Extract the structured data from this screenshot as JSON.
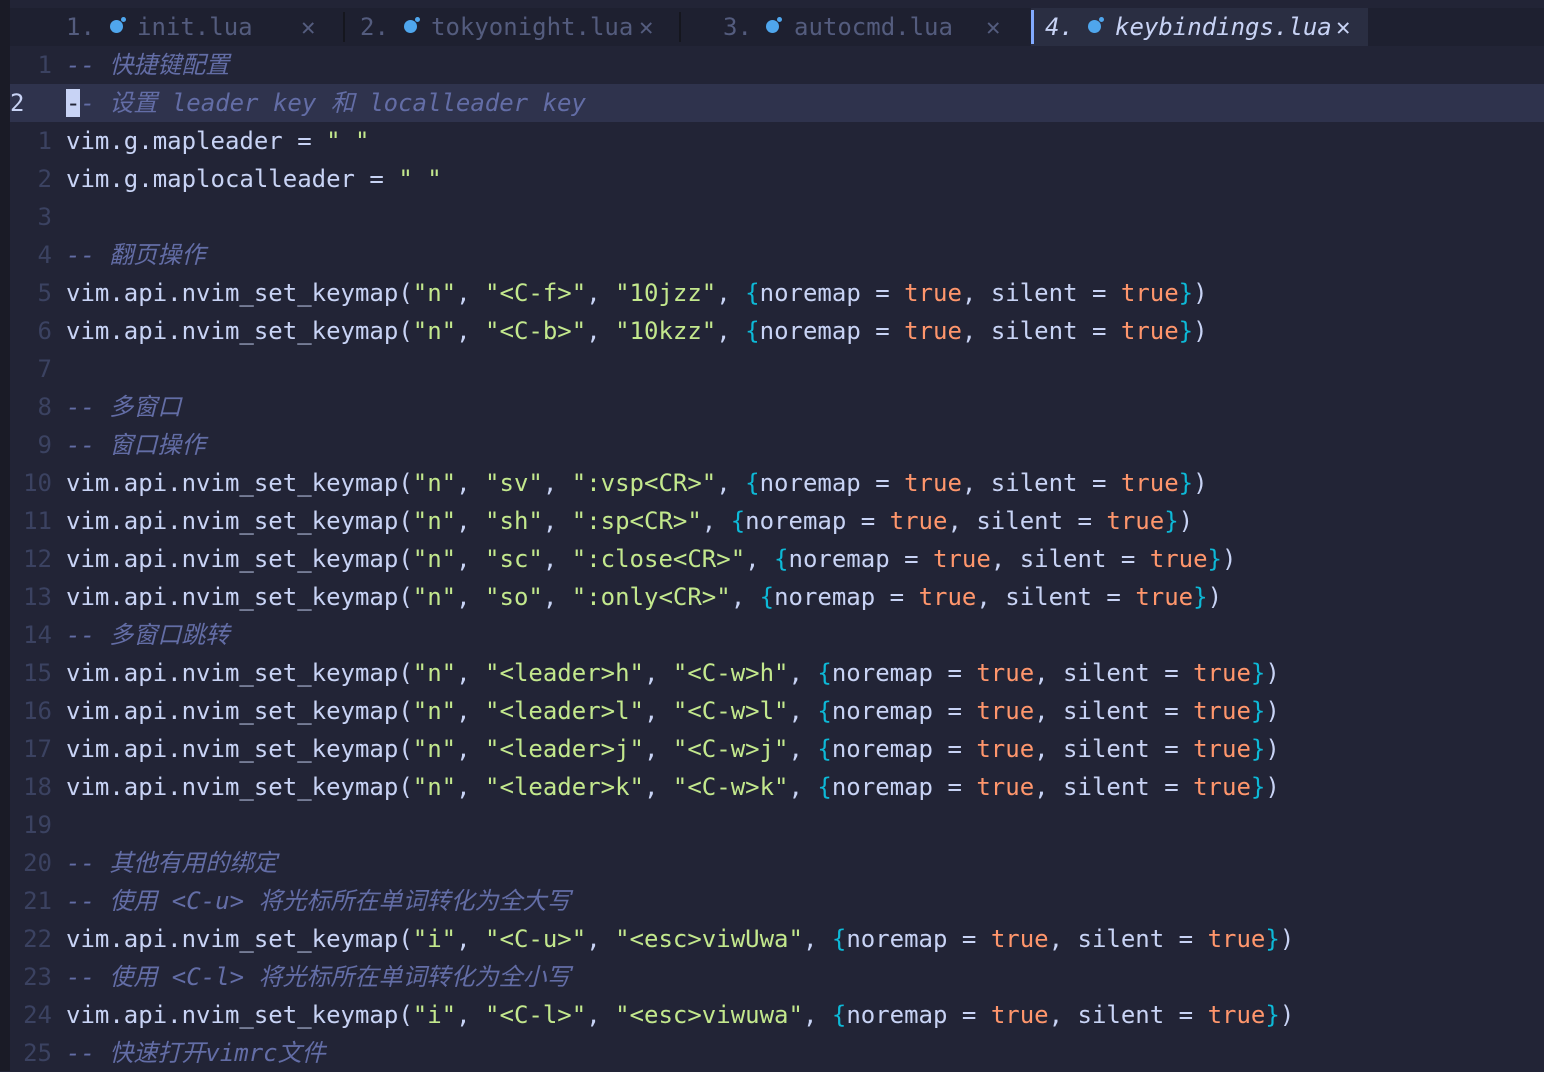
{
  "colors": {
    "background": "#222436",
    "tabbar_background": "#1e2030",
    "active_tab_background": "#2a2e42",
    "cursorline": "#2f334d",
    "foreground": "#c8d3f5",
    "comment": "#636da6",
    "string": "#c3e88d",
    "boolean": "#ff966c",
    "brace": "#0db9d7",
    "line_number": "#3b4261",
    "lua_icon": "#4fa6ed"
  },
  "tabs": [
    {
      "number": "1.",
      "name": "init.lua",
      "icon": "lua-icon",
      "close": "✕",
      "active": false
    },
    {
      "number": "2.",
      "name": "tokyonight.lua",
      "icon": "lua-icon",
      "close": "✕",
      "active": false
    },
    {
      "number": "3.",
      "name": "autocmd.lua",
      "icon": "lua-icon",
      "close": "✕",
      "active": false
    },
    {
      "number": "4.",
      "name": "keybindings.lua",
      "icon": "lua-icon",
      "close": "✕",
      "active": true
    }
  ],
  "editor": {
    "cursor_line": 2,
    "lines": [
      {
        "ln": "1",
        "cur": false,
        "tokens": [
          {
            "t": "-- 快捷键配置",
            "c": "cmt"
          }
        ]
      },
      {
        "ln": "2",
        "cur": true,
        "tokens": [
          {
            "t": "-",
            "c": "cursor"
          },
          {
            "t": "- 设置 leader key 和 localleader key",
            "c": "cmt"
          }
        ]
      },
      {
        "ln": "1",
        "cur": false,
        "tokens": [
          {
            "t": "vim.g.mapleader = ",
            "c": "punc"
          },
          {
            "t": "\" \"",
            "c": "str"
          }
        ]
      },
      {
        "ln": "2",
        "cur": false,
        "tokens": [
          {
            "t": "vim.g.maplocalleader = ",
            "c": "punc"
          },
          {
            "t": "\" \"",
            "c": "str"
          }
        ]
      },
      {
        "ln": "3",
        "cur": false,
        "tokens": []
      },
      {
        "ln": "4",
        "cur": false,
        "tokens": [
          {
            "t": "-- 翻页操作",
            "c": "cmt"
          }
        ]
      },
      {
        "ln": "5",
        "cur": false,
        "tokens": [
          {
            "t": "vim.api.nvim_set_keymap(",
            "c": "punc"
          },
          {
            "t": "\"n\"",
            "c": "str"
          },
          {
            "t": ", ",
            "c": "punc"
          },
          {
            "t": "\"<C-f>\"",
            "c": "str"
          },
          {
            "t": ", ",
            "c": "punc"
          },
          {
            "t": "\"10jzz\"",
            "c": "str"
          },
          {
            "t": ", ",
            "c": "punc"
          },
          {
            "t": "{",
            "c": "brace"
          },
          {
            "t": "noremap = ",
            "c": "punc"
          },
          {
            "t": "true",
            "c": "bool"
          },
          {
            "t": ", silent = ",
            "c": "punc"
          },
          {
            "t": "true",
            "c": "bool"
          },
          {
            "t": "}",
            "c": "brace"
          },
          {
            "t": ")",
            "c": "punc"
          }
        ]
      },
      {
        "ln": "6",
        "cur": false,
        "tokens": [
          {
            "t": "vim.api.nvim_set_keymap(",
            "c": "punc"
          },
          {
            "t": "\"n\"",
            "c": "str"
          },
          {
            "t": ", ",
            "c": "punc"
          },
          {
            "t": "\"<C-b>\"",
            "c": "str"
          },
          {
            "t": ", ",
            "c": "punc"
          },
          {
            "t": "\"10kzz\"",
            "c": "str"
          },
          {
            "t": ", ",
            "c": "punc"
          },
          {
            "t": "{",
            "c": "brace"
          },
          {
            "t": "noremap = ",
            "c": "punc"
          },
          {
            "t": "true",
            "c": "bool"
          },
          {
            "t": ", silent = ",
            "c": "punc"
          },
          {
            "t": "true",
            "c": "bool"
          },
          {
            "t": "}",
            "c": "brace"
          },
          {
            "t": ")",
            "c": "punc"
          }
        ]
      },
      {
        "ln": "7",
        "cur": false,
        "tokens": []
      },
      {
        "ln": "8",
        "cur": false,
        "tokens": [
          {
            "t": "-- 多窗口",
            "c": "cmt"
          }
        ]
      },
      {
        "ln": "9",
        "cur": false,
        "tokens": [
          {
            "t": "-- 窗口操作",
            "c": "cmt"
          }
        ]
      },
      {
        "ln": "10",
        "cur": false,
        "tokens": [
          {
            "t": "vim.api.nvim_set_keymap(",
            "c": "punc"
          },
          {
            "t": "\"n\"",
            "c": "str"
          },
          {
            "t": ", ",
            "c": "punc"
          },
          {
            "t": "\"sv\"",
            "c": "str"
          },
          {
            "t": ", ",
            "c": "punc"
          },
          {
            "t": "\":vsp<CR>\"",
            "c": "str"
          },
          {
            "t": ", ",
            "c": "punc"
          },
          {
            "t": "{",
            "c": "brace"
          },
          {
            "t": "noremap = ",
            "c": "punc"
          },
          {
            "t": "true",
            "c": "bool"
          },
          {
            "t": ", silent = ",
            "c": "punc"
          },
          {
            "t": "true",
            "c": "bool"
          },
          {
            "t": "}",
            "c": "brace"
          },
          {
            "t": ")",
            "c": "punc"
          }
        ]
      },
      {
        "ln": "11",
        "cur": false,
        "tokens": [
          {
            "t": "vim.api.nvim_set_keymap(",
            "c": "punc"
          },
          {
            "t": "\"n\"",
            "c": "str"
          },
          {
            "t": ", ",
            "c": "punc"
          },
          {
            "t": "\"sh\"",
            "c": "str"
          },
          {
            "t": ", ",
            "c": "punc"
          },
          {
            "t": "\":sp<CR>\"",
            "c": "str"
          },
          {
            "t": ", ",
            "c": "punc"
          },
          {
            "t": "{",
            "c": "brace"
          },
          {
            "t": "noremap = ",
            "c": "punc"
          },
          {
            "t": "true",
            "c": "bool"
          },
          {
            "t": ", silent = ",
            "c": "punc"
          },
          {
            "t": "true",
            "c": "bool"
          },
          {
            "t": "}",
            "c": "brace"
          },
          {
            "t": ")",
            "c": "punc"
          }
        ]
      },
      {
        "ln": "12",
        "cur": false,
        "tokens": [
          {
            "t": "vim.api.nvim_set_keymap(",
            "c": "punc"
          },
          {
            "t": "\"n\"",
            "c": "str"
          },
          {
            "t": ", ",
            "c": "punc"
          },
          {
            "t": "\"sc\"",
            "c": "str"
          },
          {
            "t": ", ",
            "c": "punc"
          },
          {
            "t": "\":close<CR>\"",
            "c": "str"
          },
          {
            "t": ", ",
            "c": "punc"
          },
          {
            "t": "{",
            "c": "brace"
          },
          {
            "t": "noremap = ",
            "c": "punc"
          },
          {
            "t": "true",
            "c": "bool"
          },
          {
            "t": ", silent = ",
            "c": "punc"
          },
          {
            "t": "true",
            "c": "bool"
          },
          {
            "t": "}",
            "c": "brace"
          },
          {
            "t": ")",
            "c": "punc"
          }
        ]
      },
      {
        "ln": "13",
        "cur": false,
        "tokens": [
          {
            "t": "vim.api.nvim_set_keymap(",
            "c": "punc"
          },
          {
            "t": "\"n\"",
            "c": "str"
          },
          {
            "t": ", ",
            "c": "punc"
          },
          {
            "t": "\"so\"",
            "c": "str"
          },
          {
            "t": ", ",
            "c": "punc"
          },
          {
            "t": "\":only<CR>\"",
            "c": "str"
          },
          {
            "t": ", ",
            "c": "punc"
          },
          {
            "t": "{",
            "c": "brace"
          },
          {
            "t": "noremap = ",
            "c": "punc"
          },
          {
            "t": "true",
            "c": "bool"
          },
          {
            "t": ", silent = ",
            "c": "punc"
          },
          {
            "t": "true",
            "c": "bool"
          },
          {
            "t": "}",
            "c": "brace"
          },
          {
            "t": ")",
            "c": "punc"
          }
        ]
      },
      {
        "ln": "14",
        "cur": false,
        "tokens": [
          {
            "t": "-- 多窗口跳转",
            "c": "cmt"
          }
        ]
      },
      {
        "ln": "15",
        "cur": false,
        "tokens": [
          {
            "t": "vim.api.nvim_set_keymap(",
            "c": "punc"
          },
          {
            "t": "\"n\"",
            "c": "str"
          },
          {
            "t": ", ",
            "c": "punc"
          },
          {
            "t": "\"<leader>h\"",
            "c": "str"
          },
          {
            "t": ", ",
            "c": "punc"
          },
          {
            "t": "\"<C-w>h\"",
            "c": "str"
          },
          {
            "t": ", ",
            "c": "punc"
          },
          {
            "t": "{",
            "c": "brace"
          },
          {
            "t": "noremap = ",
            "c": "punc"
          },
          {
            "t": "true",
            "c": "bool"
          },
          {
            "t": ", silent = ",
            "c": "punc"
          },
          {
            "t": "true",
            "c": "bool"
          },
          {
            "t": "}",
            "c": "brace"
          },
          {
            "t": ")",
            "c": "punc"
          }
        ]
      },
      {
        "ln": "16",
        "cur": false,
        "tokens": [
          {
            "t": "vim.api.nvim_set_keymap(",
            "c": "punc"
          },
          {
            "t": "\"n\"",
            "c": "str"
          },
          {
            "t": ", ",
            "c": "punc"
          },
          {
            "t": "\"<leader>l\"",
            "c": "str"
          },
          {
            "t": ", ",
            "c": "punc"
          },
          {
            "t": "\"<C-w>l\"",
            "c": "str"
          },
          {
            "t": ", ",
            "c": "punc"
          },
          {
            "t": "{",
            "c": "brace"
          },
          {
            "t": "noremap = ",
            "c": "punc"
          },
          {
            "t": "true",
            "c": "bool"
          },
          {
            "t": ", silent = ",
            "c": "punc"
          },
          {
            "t": "true",
            "c": "bool"
          },
          {
            "t": "}",
            "c": "brace"
          },
          {
            "t": ")",
            "c": "punc"
          }
        ]
      },
      {
        "ln": "17",
        "cur": false,
        "tokens": [
          {
            "t": "vim.api.nvim_set_keymap(",
            "c": "punc"
          },
          {
            "t": "\"n\"",
            "c": "str"
          },
          {
            "t": ", ",
            "c": "punc"
          },
          {
            "t": "\"<leader>j\"",
            "c": "str"
          },
          {
            "t": ", ",
            "c": "punc"
          },
          {
            "t": "\"<C-w>j\"",
            "c": "str"
          },
          {
            "t": ", ",
            "c": "punc"
          },
          {
            "t": "{",
            "c": "brace"
          },
          {
            "t": "noremap = ",
            "c": "punc"
          },
          {
            "t": "true",
            "c": "bool"
          },
          {
            "t": ", silent = ",
            "c": "punc"
          },
          {
            "t": "true",
            "c": "bool"
          },
          {
            "t": "}",
            "c": "brace"
          },
          {
            "t": ")",
            "c": "punc"
          }
        ]
      },
      {
        "ln": "18",
        "cur": false,
        "tokens": [
          {
            "t": "vim.api.nvim_set_keymap(",
            "c": "punc"
          },
          {
            "t": "\"n\"",
            "c": "str"
          },
          {
            "t": ", ",
            "c": "punc"
          },
          {
            "t": "\"<leader>k\"",
            "c": "str"
          },
          {
            "t": ", ",
            "c": "punc"
          },
          {
            "t": "\"<C-w>k\"",
            "c": "str"
          },
          {
            "t": ", ",
            "c": "punc"
          },
          {
            "t": "{",
            "c": "brace"
          },
          {
            "t": "noremap = ",
            "c": "punc"
          },
          {
            "t": "true",
            "c": "bool"
          },
          {
            "t": ", silent = ",
            "c": "punc"
          },
          {
            "t": "true",
            "c": "bool"
          },
          {
            "t": "}",
            "c": "brace"
          },
          {
            "t": ")",
            "c": "punc"
          }
        ]
      },
      {
        "ln": "19",
        "cur": false,
        "tokens": []
      },
      {
        "ln": "20",
        "cur": false,
        "tokens": [
          {
            "t": "-- 其他有用的绑定",
            "c": "cmt"
          }
        ]
      },
      {
        "ln": "21",
        "cur": false,
        "tokens": [
          {
            "t": "-- 使用 <C-u> 将光标所在单词转化为全大写",
            "c": "cmt"
          }
        ]
      },
      {
        "ln": "22",
        "cur": false,
        "tokens": [
          {
            "t": "vim.api.nvim_set_keymap(",
            "c": "punc"
          },
          {
            "t": "\"i\"",
            "c": "str"
          },
          {
            "t": ", ",
            "c": "punc"
          },
          {
            "t": "\"<C-u>\"",
            "c": "str"
          },
          {
            "t": ", ",
            "c": "punc"
          },
          {
            "t": "\"<esc>viwUwa\"",
            "c": "str"
          },
          {
            "t": ", ",
            "c": "punc"
          },
          {
            "t": "{",
            "c": "brace"
          },
          {
            "t": "noremap = ",
            "c": "punc"
          },
          {
            "t": "true",
            "c": "bool"
          },
          {
            "t": ", silent = ",
            "c": "punc"
          },
          {
            "t": "true",
            "c": "bool"
          },
          {
            "t": "}",
            "c": "brace"
          },
          {
            "t": ")",
            "c": "punc"
          }
        ]
      },
      {
        "ln": "23",
        "cur": false,
        "tokens": [
          {
            "t": "-- 使用 <C-l> 将光标所在单词转化为全小写",
            "c": "cmt"
          }
        ]
      },
      {
        "ln": "24",
        "cur": false,
        "tokens": [
          {
            "t": "vim.api.nvim_set_keymap(",
            "c": "punc"
          },
          {
            "t": "\"i\"",
            "c": "str"
          },
          {
            "t": ", ",
            "c": "punc"
          },
          {
            "t": "\"<C-l>\"",
            "c": "str"
          },
          {
            "t": ", ",
            "c": "punc"
          },
          {
            "t": "\"<esc>viwuwa\"",
            "c": "str"
          },
          {
            "t": ", ",
            "c": "punc"
          },
          {
            "t": "{",
            "c": "brace"
          },
          {
            "t": "noremap = ",
            "c": "punc"
          },
          {
            "t": "true",
            "c": "bool"
          },
          {
            "t": ", silent = ",
            "c": "punc"
          },
          {
            "t": "true",
            "c": "bool"
          },
          {
            "t": "}",
            "c": "brace"
          },
          {
            "t": ")",
            "c": "punc"
          }
        ]
      },
      {
        "ln": "25",
        "cur": false,
        "tokens": [
          {
            "t": "-- 快速打开vimrc文件",
            "c": "cmt"
          }
        ]
      }
    ]
  }
}
